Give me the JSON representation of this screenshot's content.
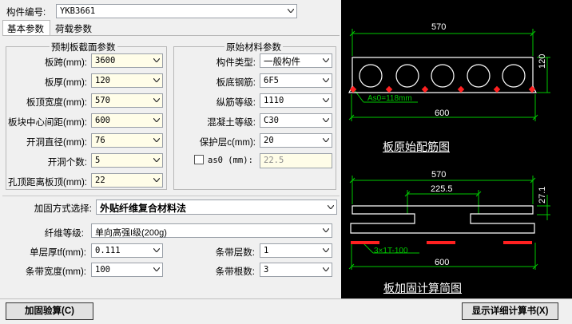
{
  "component": {
    "label": "构件编号:",
    "value": "YKB3661"
  },
  "tabs": [
    "基本参数",
    "荷载参数"
  ],
  "prefab": {
    "title": "预制板截面参数",
    "rows": [
      {
        "label": "板跨(mm):",
        "value": "3600"
      },
      {
        "label": "板厚(mm):",
        "value": "120"
      },
      {
        "label": "板顶宽度(mm):",
        "value": "570"
      },
      {
        "label": "板块中心间距(mm):",
        "value": "600"
      },
      {
        "label": "开洞直径(mm):",
        "value": "76"
      },
      {
        "label": "开洞个数:",
        "value": "5"
      },
      {
        "label": "孔顶距离板顶(mm):",
        "value": "22"
      }
    ]
  },
  "material": {
    "title": "原始材料参数",
    "rows": [
      {
        "label": "构件类型:",
        "value": "一般构件"
      },
      {
        "label": "板底钢筋:",
        "value": "6F5"
      },
      {
        "label": "纵筋等级:",
        "value": "1110"
      },
      {
        "label": "混凝土等级:",
        "value": "C30"
      },
      {
        "label": "保护层c(mm):",
        "value": "20"
      }
    ],
    "as0": {
      "label": "as0 (mm):",
      "value": "22.5",
      "checked": false
    }
  },
  "method": {
    "label": "加固方式选择:",
    "value": "外贴纤维复合材料法"
  },
  "fiber": {
    "label": "纤维等级:",
    "value": "单向高强I级(200g)"
  },
  "thickness": {
    "label": "单层厚tf(mm):",
    "value": "0.111"
  },
  "layers": {
    "label": "条带层数:",
    "value": "1"
  },
  "strip_width": {
    "label": "条带宽度(mm):",
    "value": "100"
  },
  "strip_count": {
    "label": "条带根数:",
    "value": "3"
  },
  "buttons": {
    "verify": "加固验算(C)",
    "report": "显示详细计算书(X)"
  },
  "drawing1": {
    "top_width": "570",
    "height": "120",
    "rebar_note": "As0=118mm",
    "bottom_width": "600",
    "caption": "板原始配筋图"
  },
  "drawing2": {
    "top_width": "570",
    "inner_width": "225.5",
    "height": "27.1",
    "strip_note": "3×1T-100",
    "bottom_width": "600",
    "caption": "板加固计算简图"
  },
  "colors": {
    "cad_bg": "#000000",
    "dim": "#00c800",
    "rebar": "#ff2020",
    "strip": "#ff2020",
    "field": "#fffde8"
  }
}
